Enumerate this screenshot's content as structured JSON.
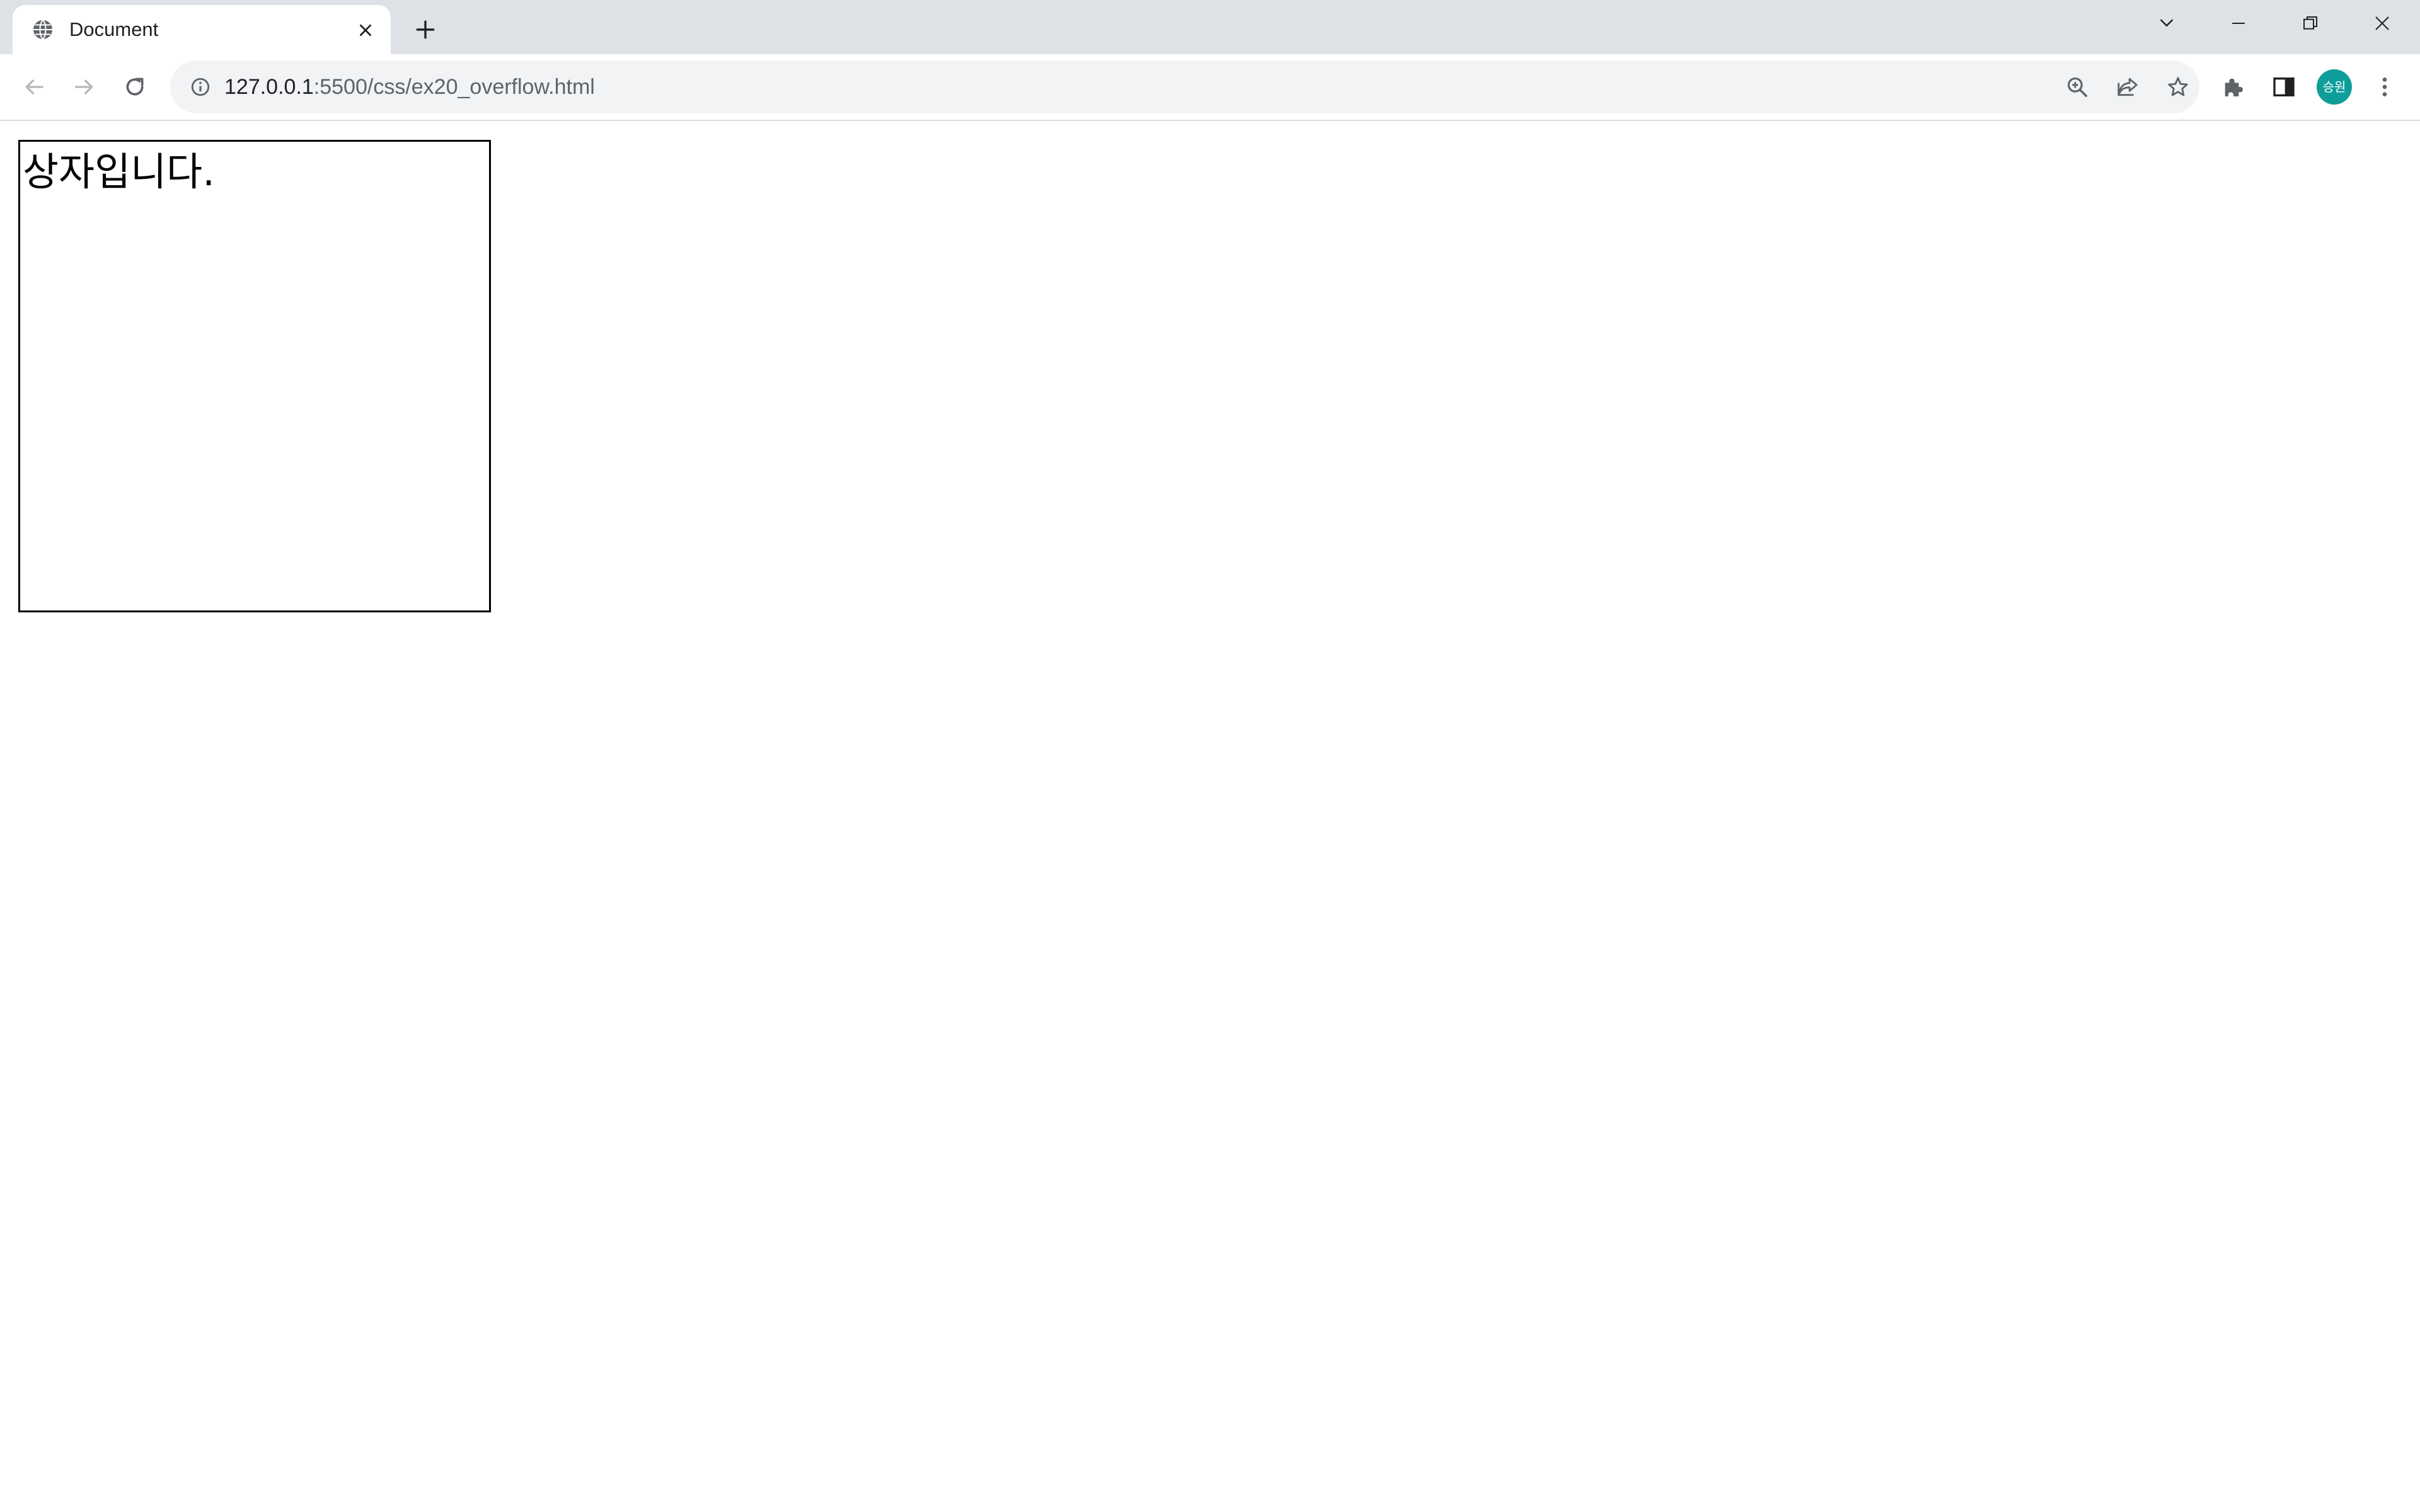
{
  "tab": {
    "title": "Document",
    "favicon": "globe-icon",
    "close_icon": "close-icon"
  },
  "tabstrip": {
    "new_tab_icon": "plus-icon",
    "tab_search_icon": "chevron-down-icon"
  },
  "window_controls": [
    "minimize-icon",
    "restore-icon",
    "close-icon"
  ],
  "toolbar": {
    "nav_icons": [
      "back-arrow-icon",
      "forward-arrow-icon",
      "reload-icon"
    ],
    "omnibox": {
      "info_icon": "info-icon",
      "url_host": "127.0.0.1",
      "url_path": ":5500/css/ex20_overflow.html",
      "action_icons": [
        "zoom-icon",
        "share-icon",
        "star-icon"
      ]
    },
    "right_icons": [
      "extensions-puzzle-icon",
      "side-panel-icon",
      "kebab-menu-icon"
    ],
    "profile_avatar_text": "승원"
  },
  "page": {
    "box_text": "상자입니다."
  },
  "colors": {
    "tabstrip_bg": "#dee1e6",
    "omnibox_bg": "#f1f3f4",
    "avatar_bg": "#0f9d9a",
    "box_border": "#000000"
  }
}
